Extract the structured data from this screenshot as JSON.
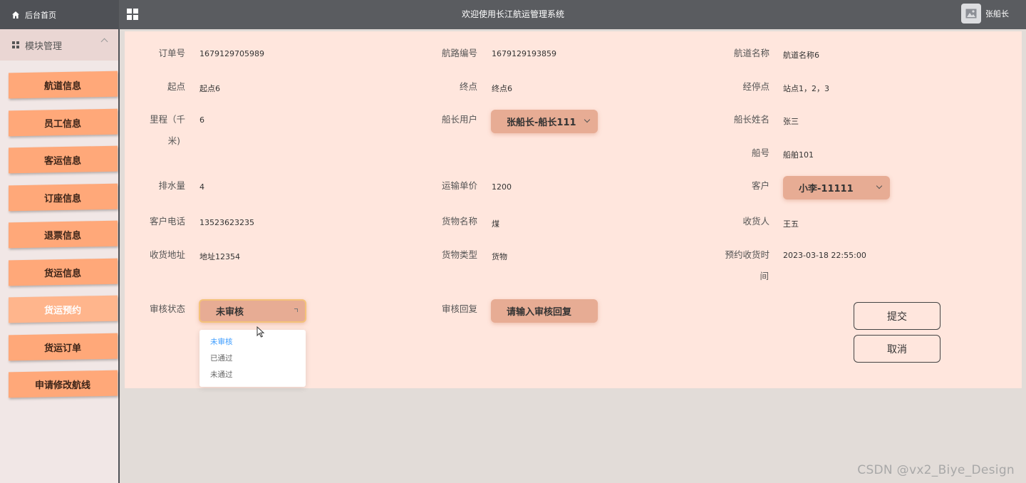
{
  "header": {
    "home_label": "后台首页",
    "title": "欢迎使用长江航运管理系统",
    "user_name": "张船长"
  },
  "sidebar": {
    "module_label": "模块管理",
    "items": [
      {
        "label": "航道信息"
      },
      {
        "label": "员工信息"
      },
      {
        "label": "客运信息"
      },
      {
        "label": "订座信息"
      },
      {
        "label": "退票信息"
      },
      {
        "label": "货运信息"
      },
      {
        "label": "货运预约",
        "active": true
      },
      {
        "label": "货运订单"
      },
      {
        "label": "申请修改航线"
      }
    ]
  },
  "form": {
    "order_no": {
      "label": "订单号",
      "value": "1679129705989"
    },
    "route_no": {
      "label": "航路编号",
      "value": "1679129193859"
    },
    "channel_name": {
      "label": "航道名称",
      "value": "航道名称6"
    },
    "start": {
      "label": "起点",
      "value": "起点6"
    },
    "end": {
      "label": "终点",
      "value": "终点6"
    },
    "stops": {
      "label": "经停点",
      "value": "站点1，2，3"
    },
    "mileage": {
      "label_line1": "里程（千",
      "label_line2": "米)",
      "value": "6"
    },
    "captain_user": {
      "label": "船长用户",
      "value": "张船长-船长111"
    },
    "captain_name": {
      "label": "船长姓名",
      "value": "张三"
    },
    "ship_no": {
      "label": "船号",
      "value": "船舶101"
    },
    "displacement": {
      "label": "排水量",
      "value": "4"
    },
    "unit_price": {
      "label": "运输单价",
      "value": "1200"
    },
    "customer": {
      "label": "客户",
      "value": "小李-11111"
    },
    "customer_phone": {
      "label": "客户电话",
      "value": "13523623235"
    },
    "goods_name": {
      "label": "货物名称",
      "value": "煤"
    },
    "receiver": {
      "label": "收货人",
      "value": "王五"
    },
    "receive_address": {
      "label": "收货地址",
      "value": "地址12354"
    },
    "goods_type": {
      "label": "货物类型",
      "value": "货物"
    },
    "reserve_time": {
      "label_line1": "预约收货时",
      "label_line2": "间",
      "value": "2023-03-18 22:55:00"
    },
    "review_status": {
      "label": "审核状态",
      "value": "未审核",
      "options": [
        "未审核",
        "已通过",
        "未通过"
      ]
    },
    "review_reply": {
      "label": "审核回复",
      "placeholder": "请输入审核回复"
    }
  },
  "buttons": {
    "submit": "提交",
    "cancel": "取消"
  },
  "watermark": "CSDN @vx2_Biye_Design",
  "colors": {
    "menu_item": "#ffa879",
    "panel_bg": "#ffe6dd",
    "topbar": "#5a5c60",
    "select_bg": "#e7ac94",
    "option_selected": "#409eff"
  }
}
